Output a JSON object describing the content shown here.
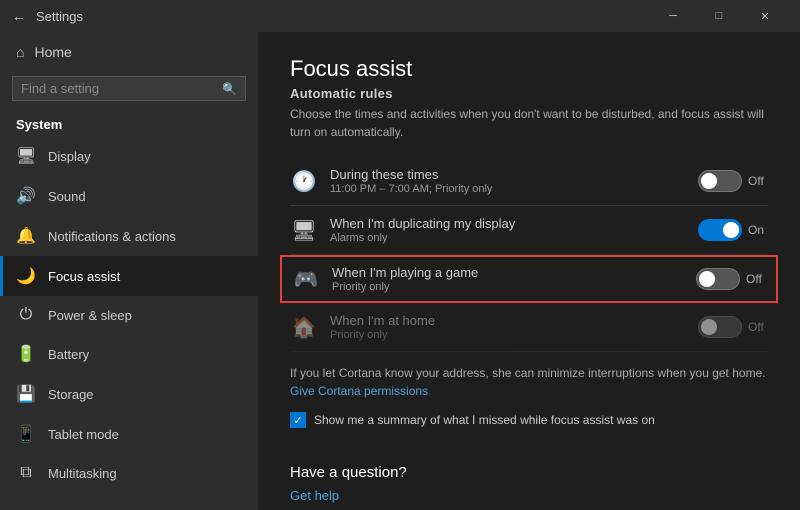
{
  "titlebar": {
    "back_icon": "←",
    "title": "Settings",
    "minimize_icon": "─",
    "maximize_icon": "□",
    "close_icon": "✕"
  },
  "sidebar": {
    "home_label": "Home",
    "search_placeholder": "Find a setting",
    "section_title": "System",
    "items": [
      {
        "id": "display",
        "label": "Display",
        "icon": "🖥"
      },
      {
        "id": "sound",
        "label": "Sound",
        "icon": "🔊"
      },
      {
        "id": "notifications",
        "label": "Notifications & actions",
        "icon": "🔔"
      },
      {
        "id": "focus-assist",
        "label": "Focus assist",
        "icon": "🌙"
      },
      {
        "id": "power",
        "label": "Power & sleep",
        "icon": "⏻"
      },
      {
        "id": "battery",
        "label": "Battery",
        "icon": "🔋"
      },
      {
        "id": "storage",
        "label": "Storage",
        "icon": "💾"
      },
      {
        "id": "tablet",
        "label": "Tablet mode",
        "icon": "📱"
      },
      {
        "id": "multitasking",
        "label": "Multitasking",
        "icon": "⧉"
      }
    ]
  },
  "content": {
    "title": "Focus assist",
    "automatic_rules_label": "Automatic rules",
    "automatic_rules_desc": "Choose the times and activities when you don't want to be disturbed, and focus assist will turn on automatically.",
    "rules": [
      {
        "id": "during-times",
        "icon": "🕐",
        "title": "During these times",
        "subtitle": "11:00 PM – 7:00 AM; Priority only",
        "toggle": "off",
        "toggle_label": "Off"
      },
      {
        "id": "duplicating-display",
        "icon": "🖥",
        "title": "When I'm duplicating my display",
        "subtitle": "Alarms only",
        "toggle": "on",
        "toggle_label": "On"
      },
      {
        "id": "playing-game",
        "icon": "🎮",
        "title": "When I'm playing a game",
        "subtitle": "Priority only",
        "toggle": "off",
        "toggle_label": "Off",
        "highlighted": true
      },
      {
        "id": "at-home",
        "icon": "🏠",
        "title": "When I'm at home",
        "subtitle": "Priority only",
        "toggle": "off",
        "toggle_label": "Off",
        "dimmed": true
      }
    ],
    "cortana_note": "If you let Cortana know your address, she can minimize interruptions when you get home.",
    "cortana_link": "Give Cortana permissions",
    "checkbox_label": "Show me a summary of what I missed while focus assist was on",
    "question_title": "Have a question?",
    "get_help_link": "Get help"
  }
}
